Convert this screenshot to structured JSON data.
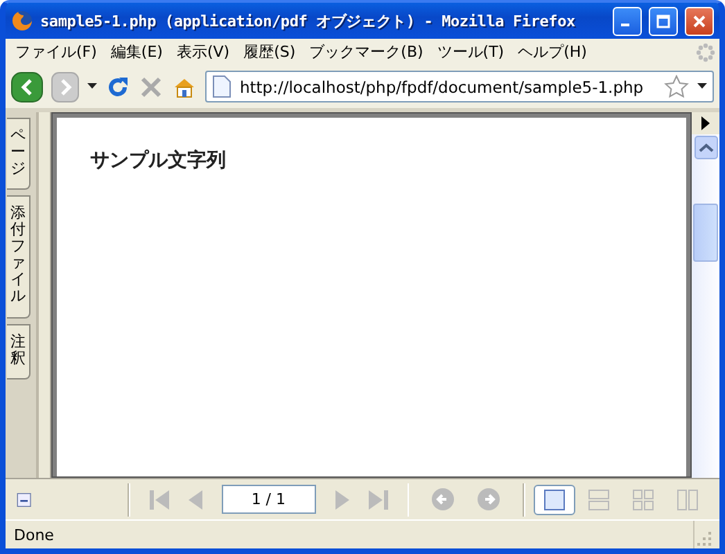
{
  "window": {
    "title": "sample5-1.php (application/pdf オブジェクト) - Mozilla Firefox"
  },
  "menu": [
    "ファイル(F)",
    "編集(E)",
    "表示(V)",
    "履歴(S)",
    "ブックマーク(B)",
    "ツール(T)",
    "ヘルプ(H)"
  ],
  "address_bar": {
    "value": "http://localhost/php/fpdf/document/sample5-1.php"
  },
  "side_tabs": [
    "ページ",
    "添付ファイル",
    "注釈"
  ],
  "document": {
    "text": "サンプル文字列"
  },
  "pdf_toolbar": {
    "page": "1 / 1",
    "view_modes": [
      {
        "kind": "single",
        "selected": true
      },
      {
        "kind": "continuous",
        "selected": false
      },
      {
        "kind": "grid",
        "selected": false
      },
      {
        "kind": "facing",
        "selected": false
      }
    ]
  },
  "status_bar": {
    "text": "Done"
  }
}
